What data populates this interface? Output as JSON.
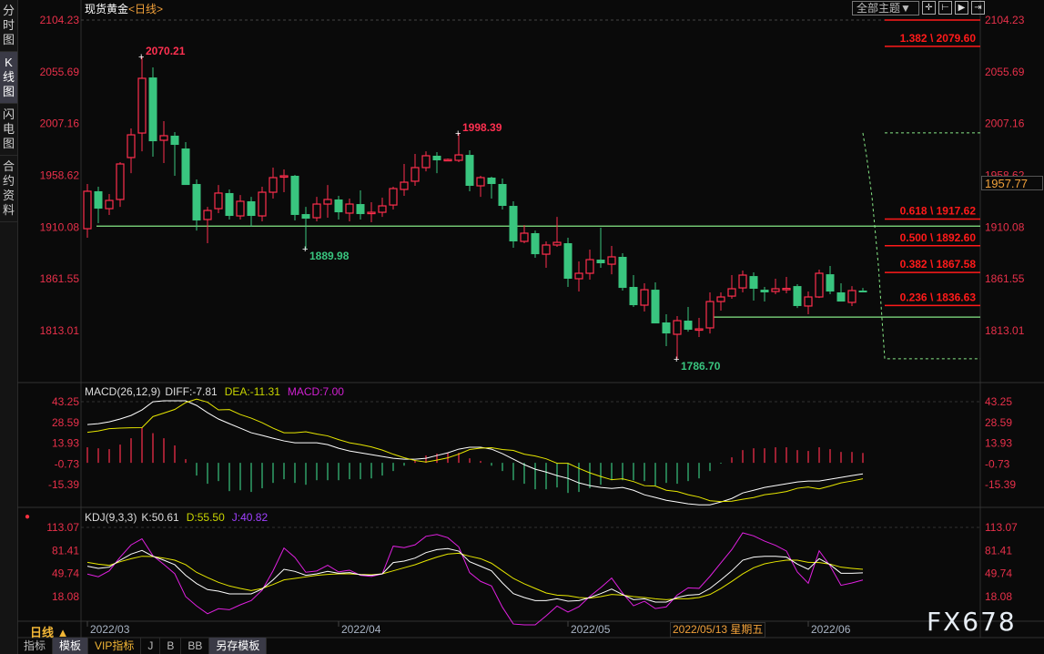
{
  "sidebar": {
    "tabs": [
      {
        "label": "分时图",
        "active": false
      },
      {
        "label": "K线图",
        "active": true
      },
      {
        "label": "闪电图",
        "active": false
      },
      {
        "label": "合约资料",
        "active": false
      }
    ]
  },
  "header": {
    "instrument": "现货黄金",
    "period": "<日线>",
    "theme_button": "全部主题▼",
    "icons": [
      "crosshair-icon",
      "zoom-range-icon",
      "play-range-icon",
      "goto-end-icon"
    ]
  },
  "current_price": "1957.77",
  "colors": {
    "up": "#ff2e4d",
    "down": "#39c57f",
    "diff": "#ffffff",
    "dea": "#e6e600",
    "j": "#e020e0",
    "fib": "#ff1a1a",
    "level": "#86e886"
  },
  "chart_data": {
    "type": "candlestick",
    "price_axis_ticks": [
      "2104.23",
      "2055.69",
      "2007.16",
      "1958.62",
      "1910.08",
      "1861.55",
      "1813.01"
    ],
    "x_labels": [
      {
        "i": 0,
        "label": "2022/03"
      },
      {
        "i": 23,
        "label": "2022/04"
      },
      {
        "i": 44,
        "label": "2022/05"
      },
      {
        "i": 66,
        "label": "2022/06"
      }
    ],
    "crosshair_date": "2022/05/13 星期五",
    "annotations": [
      {
        "i": 5,
        "price": 2070.21,
        "label": "2070.21",
        "kind": "high"
      },
      {
        "i": 34,
        "price": 1998.39,
        "label": "1998.39",
        "kind": "high"
      },
      {
        "i": 20,
        "price": 1889.98,
        "label": "1889.98",
        "kind": "low"
      },
      {
        "i": 54,
        "price": 1786.7,
        "label": "1786.70",
        "kind": "low"
      }
    ],
    "fib_levels": [
      {
        "label": "",
        "price": 2104.23
      },
      {
        "label": "1.382 \\ 2079.60",
        "price": 2079.6
      },
      {
        "label": "0.618 \\ 1917.62",
        "price": 1917.62
      },
      {
        "label": "0.500 \\ 1892.60",
        "price": 1892.6
      },
      {
        "label": "0.382 \\ 1867.58",
        "price": 1867.58
      },
      {
        "label": "0.236 \\ 1836.63",
        "price": 1836.63
      }
    ],
    "horizontal_lines": [
      {
        "price": 1911.0,
        "from_i": 1
      },
      {
        "price": 1825.7,
        "from_i": 57
      }
    ],
    "projection": {
      "high": 1998.39,
      "low": 1786.7
    },
    "ohlc": [
      [
        1908.6,
        1950.5,
        1900.1,
        1943.7
      ],
      [
        1943.7,
        1947.9,
        1913.8,
        1927.4
      ],
      [
        1927.4,
        1941.1,
        1921.5,
        1935.1
      ],
      [
        1936.0,
        1971.0,
        1929.1,
        1969.3
      ],
      [
        1975.3,
        2002.6,
        1960.7,
        1996.6
      ],
      [
        1998.3,
        2070.21,
        1981.2,
        2049.6
      ],
      [
        2050.4,
        2059.8,
        1976.1,
        1990.6
      ],
      [
        1991.5,
        2009.4,
        1970.1,
        1995.8
      ],
      [
        1995.8,
        1999.2,
        1958.2,
        1987.2
      ],
      [
        1983.8,
        1989.8,
        1949.6,
        1949.6
      ],
      [
        1950.5,
        1954.8,
        1906.9,
        1916.3
      ],
      [
        1917.2,
        1929.1,
        1895.0,
        1925.7
      ],
      [
        1927.4,
        1949.6,
        1923.2,
        1942.0
      ],
      [
        1942.0,
        1945.4,
        1917.2,
        1920.6
      ],
      [
        1920.6,
        1940.2,
        1917.2,
        1934.3
      ],
      [
        1934.3,
        1938.5,
        1910.4,
        1920.6
      ],
      [
        1920.6,
        1947.9,
        1915.5,
        1942.8
      ],
      [
        1942.8,
        1965.9,
        1936.8,
        1956.5
      ],
      [
        1957.3,
        1964.2,
        1942.8,
        1958.2
      ],
      [
        1958.2,
        1959.0,
        1916.3,
        1921.5
      ],
      [
        1922.3,
        1929.1,
        1889.98,
        1918.0
      ],
      [
        1918.9,
        1938.5,
        1915.5,
        1931.7
      ],
      [
        1931.7,
        1949.6,
        1918.9,
        1936.0
      ],
      [
        1936.0,
        1939.4,
        1917.2,
        1924.0
      ],
      [
        1923.2,
        1936.8,
        1915.5,
        1931.7
      ],
      [
        1931.7,
        1944.5,
        1917.2,
        1922.3
      ],
      [
        1923.2,
        1933.4,
        1914.6,
        1924.0
      ],
      [
        1924.0,
        1937.7,
        1919.7,
        1930.0
      ],
      [
        1930.8,
        1947.9,
        1926.6,
        1946.2
      ],
      [
        1945.4,
        1969.3,
        1939.4,
        1952.2
      ],
      [
        1953.1,
        1978.7,
        1948.8,
        1965.9
      ],
      [
        1965.9,
        1981.2,
        1962.4,
        1977.0
      ],
      [
        1977.0,
        1980.4,
        1960.7,
        1972.7
      ],
      [
        1973.0,
        1974.4,
        1972.7,
        1973.5
      ],
      [
        1972.7,
        1998.39,
        1971.0,
        1977.8
      ],
      [
        1977.8,
        1982.1,
        1943.7,
        1948.8
      ],
      [
        1948.8,
        1958.2,
        1938.5,
        1956.5
      ],
      [
        1956.5,
        1957.3,
        1936.8,
        1950.5
      ],
      [
        1950.5,
        1955.6,
        1926.6,
        1930.0
      ],
      [
        1930.0,
        1934.3,
        1890.7,
        1896.7
      ],
      [
        1896.7,
        1912.0,
        1895.0,
        1904.4
      ],
      [
        1904.4,
        1906.9,
        1881.3,
        1884.7
      ],
      [
        1884.7,
        1896.7,
        1871.9,
        1893.3
      ],
      [
        1893.3,
        1919.7,
        1891.6,
        1895.8
      ],
      [
        1895.0,
        1900.1,
        1854.0,
        1861.7
      ],
      [
        1861.7,
        1877.9,
        1849.7,
        1866.8
      ],
      [
        1866.8,
        1889.0,
        1860.8,
        1879.6
      ],
      [
        1879.6,
        1909.5,
        1871.9,
        1876.2
      ],
      [
        1875.3,
        1892.4,
        1865.9,
        1882.2
      ],
      [
        1882.2,
        1885.6,
        1850.6,
        1853.1
      ],
      [
        1854.0,
        1865.1,
        1835.2,
        1836.9
      ],
      [
        1836.9,
        1857.4,
        1830.9,
        1851.4
      ],
      [
        1851.4,
        1858.3,
        1819.8,
        1819.8
      ],
      [
        1820.7,
        1828.4,
        1798.5,
        1810.4
      ],
      [
        1809.6,
        1826.7,
        1786.7,
        1822.4
      ],
      [
        1822.4,
        1835.2,
        1812.1,
        1813.9
      ],
      [
        1813.9,
        1825.0,
        1807.0,
        1814.7
      ],
      [
        1815.6,
        1848.9,
        1810.4,
        1840.3
      ],
      [
        1840.3,
        1848.9,
        1831.8,
        1844.6
      ],
      [
        1845.4,
        1865.1,
        1842.9,
        1852.3
      ],
      [
        1853.1,
        1869.4,
        1848.9,
        1865.1
      ],
      [
        1864.2,
        1867.7,
        1841.2,
        1852.3
      ],
      [
        1851.4,
        1854.0,
        1840.3,
        1848.9
      ],
      [
        1849.7,
        1861.7,
        1847.2,
        1852.3
      ],
      [
        1852.3,
        1863.4,
        1848.0,
        1852.6
      ],
      [
        1854.8,
        1856.6,
        1834.3,
        1836.1
      ],
      [
        1836.1,
        1849.7,
        1828.4,
        1844.6
      ],
      [
        1844.6,
        1870.2,
        1843.7,
        1866.8
      ],
      [
        1865.9,
        1873.6,
        1847.2,
        1849.7
      ],
      [
        1848.9,
        1857.4,
        1840.3,
        1840.3
      ],
      [
        1839.5,
        1854.8,
        1836.1,
        1850.6
      ],
      [
        1850.6,
        1853.1,
        1848.9,
        1848.9
      ]
    ],
    "macd": {
      "title": "MACD(26,12,9)",
      "diff_label": "DIFF:-7.81",
      "dea_label": "DEA:-11.31",
      "macd_label": "MACD:7.00",
      "ticks": [
        "43.25",
        "28.59",
        "13.93",
        "-0.73",
        "-15.39"
      ],
      "diff": [
        27.1,
        27.7,
        29.0,
        31.0,
        33.5,
        37.4,
        43.2,
        43.9,
        43.9,
        43.9,
        40.6,
        35.5,
        31.0,
        27.7,
        24.5,
        21.3,
        19.4,
        17.4,
        15.5,
        14.2,
        14.2,
        14.2,
        12.9,
        10.3,
        8.4,
        7.1,
        5.8,
        4.5,
        3.2,
        2.6,
        2.6,
        3.2,
        5.2,
        7.1,
        9.7,
        11.0,
        11.0,
        9.7,
        6.5,
        2.6,
        -1.3,
        -4.5,
        -6.5,
        -9.0,
        -11.0,
        -14.2,
        -16.1,
        -17.4,
        -18.1,
        -17.4,
        -19.4,
        -22.6,
        -24.5,
        -26.5,
        -27.7,
        -29.0,
        -29.7,
        -29.7,
        -27.7,
        -25.2,
        -21.3,
        -19.4,
        -17.4,
        -16.1,
        -14.8,
        -13.5,
        -12.9,
        -12.9,
        -11.6,
        -10.3,
        -9.0,
        -7.81
      ],
      "hist": [
        11,
        10.3,
        9.7,
        12.9,
        17.4,
        25,
        21,
        17.4,
        12.3,
        2.6,
        -9,
        -14.8,
        -12.9,
        -20,
        -19.4,
        -20.6,
        -18,
        -14.2,
        -11.6,
        -14.2,
        -15.5,
        -12.3,
        -12.3,
        -12.3,
        -11.6,
        -11.6,
        -11,
        -9,
        -5.8,
        -2,
        1.9,
        5.2,
        6.5,
        7.1,
        7.1,
        3.2,
        1.3,
        -2,
        -5.8,
        -12.3,
        -14.8,
        -18.7,
        -18.7,
        -17.4,
        -21.3,
        -20.6,
        -18,
        -15.5,
        -12.3,
        -12.3,
        -12.3,
        -12.9,
        -16.1,
        -14.2,
        -14.8,
        -12.9,
        -11,
        -5.8,
        -0.6,
        3.9,
        9,
        10.3,
        10.3,
        11,
        11,
        9,
        8.4,
        11,
        9.7,
        7.7,
        7.7,
        7.0
      ]
    },
    "kdj": {
      "title": "KDJ(9,3,3)",
      "k_label": "K:50.61",
      "d_label": "D:55.50",
      "j_label": "J:40.82",
      "ticks": [
        "113.07",
        "81.41",
        "49.74",
        "18.08"
      ],
      "k": [
        59.7,
        56.8,
        58.4,
        68.0,
        76.4,
        81.4,
        73.4,
        68.0,
        61.8,
        47.2,
        35.9,
        27.6,
        25.5,
        21.7,
        21.7,
        21.7,
        28.4,
        40.9,
        55.5,
        52.6,
        47.2,
        49.2,
        52.6,
        50.1,
        50.9,
        48.0,
        47.2,
        49.2,
        64.7,
        66.8,
        70.9,
        78.4,
        82.6,
        83.9,
        80.5,
        65.9,
        59.7,
        53.4,
        36.7,
        22.1,
        16.7,
        12.5,
        12.5,
        15.0,
        11.7,
        12.5,
        16.7,
        22.1,
        28.4,
        20.9,
        13.8,
        15.0,
        10.5,
        10.5,
        16.7,
        20.0,
        20.9,
        29.2,
        40.9,
        53.4,
        68.0,
        72.2,
        73.4,
        73.4,
        72.2,
        62.6,
        55.5,
        70.1,
        61.8,
        50.1,
        50.1,
        50.61
      ],
      "d": [
        65.1,
        62.6,
        60.9,
        65.9,
        70.1,
        73.4,
        73.0,
        70.9,
        68.0,
        61.8,
        51.3,
        44.2,
        37.6,
        32.6,
        29.2,
        26.3,
        29.2,
        34.6,
        40.9,
        43.0,
        45.1,
        47.2,
        48.4,
        49.2,
        49.2,
        48.4,
        48.0,
        49.2,
        53.4,
        57.6,
        61.8,
        67.2,
        72.2,
        76.4,
        77.6,
        73.4,
        70.1,
        63.8,
        53.4,
        43.0,
        35.5,
        29.2,
        23.0,
        20.0,
        19.2,
        16.7,
        15.9,
        18.0,
        20.9,
        20.0,
        18.0,
        16.7,
        15.0,
        13.8,
        15.0,
        15.0,
        16.7,
        20.9,
        29.2,
        38.8,
        49.2,
        57.6,
        63.0,
        65.9,
        68.0,
        68.0,
        65.1,
        64.7,
        62.6,
        58.4,
        56.8,
        55.5
      ]
    }
  },
  "footer": {
    "period_label": "日线 ▲",
    "tabs": [
      {
        "label": "指标"
      },
      {
        "label": "模板",
        "active": true
      },
      {
        "label": "VIP指标",
        "vip": true
      },
      {
        "label": "J"
      },
      {
        "label": "B"
      },
      {
        "label": "BB"
      },
      {
        "label": "另存模板",
        "active": true
      }
    ],
    "logo": "FX678"
  }
}
